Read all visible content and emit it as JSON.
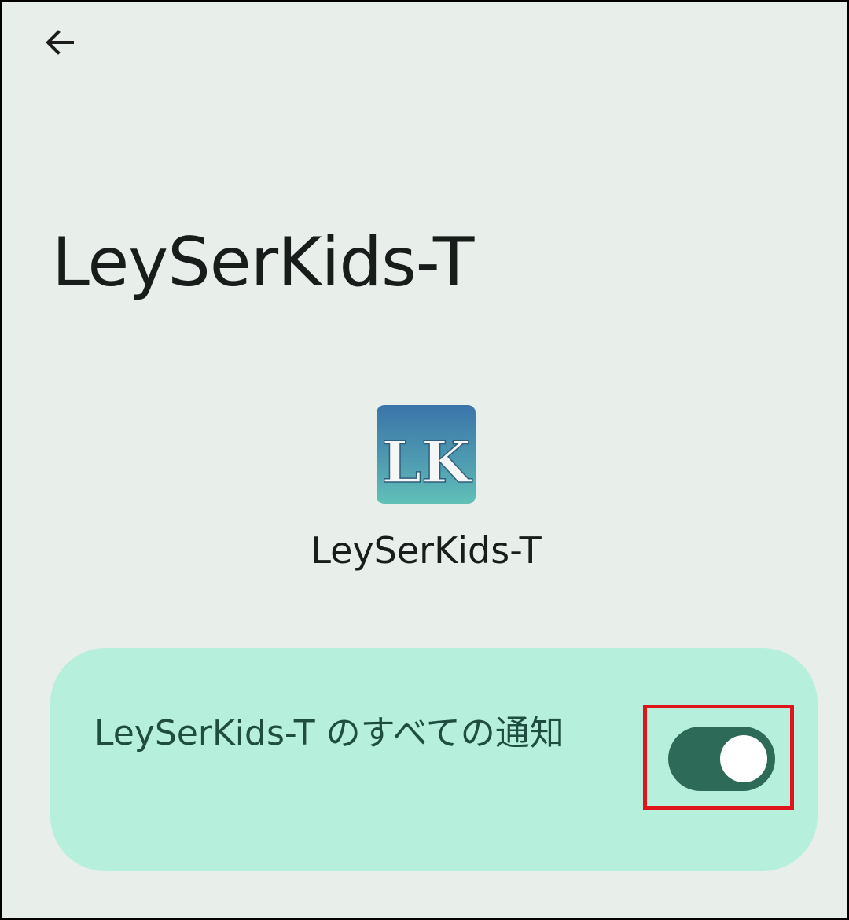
{
  "header": {
    "back_icon": "arrow-left-icon"
  },
  "page": {
    "title": "LeySerKids-T"
  },
  "app": {
    "icon": "leyserkids-app-icon",
    "icon_text": "LK",
    "name": "LeySerKids-T"
  },
  "notifications": {
    "label": "LeySerKids-T のすべての通知",
    "toggle_on": true
  },
  "colors": {
    "background": "#e8eeea",
    "card": "#b6f0dc",
    "toggle_track": "#2d6a57",
    "highlight": "#e0151b"
  }
}
